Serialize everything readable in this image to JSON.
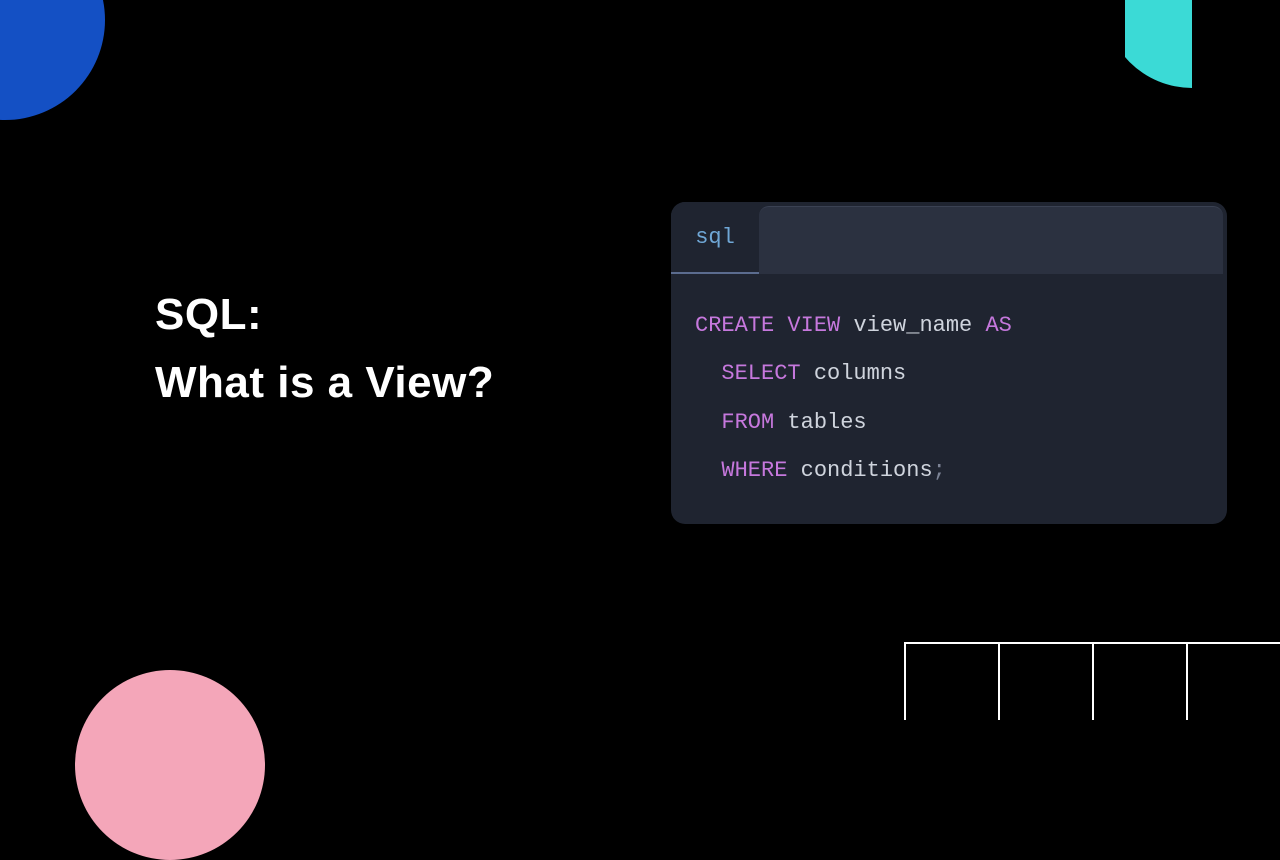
{
  "title": {
    "line1": "SQL:",
    "line2": "What is a View?"
  },
  "code": {
    "tab_label": "sql",
    "tokens": {
      "l1_kw1": "CREATE",
      "l1_kw2": "VIEW",
      "l1_ident": "view_name",
      "l1_kw3": "AS",
      "l2_kw": "SELECT",
      "l2_ident": "columns",
      "l3_kw": "FROM",
      "l3_ident": "tables",
      "l4_kw": "WHERE",
      "l4_ident": "conditions",
      "l4_punct": ";"
    }
  },
  "colors": {
    "bg": "#000000",
    "blue": "#1450C4",
    "cyan": "#3BDAD6",
    "pink": "#F4A6B9",
    "panel": "#1F2430",
    "keyword": "#C678DD",
    "identifier": "#CFD4DD",
    "tab_text": "#6FA7D6"
  }
}
